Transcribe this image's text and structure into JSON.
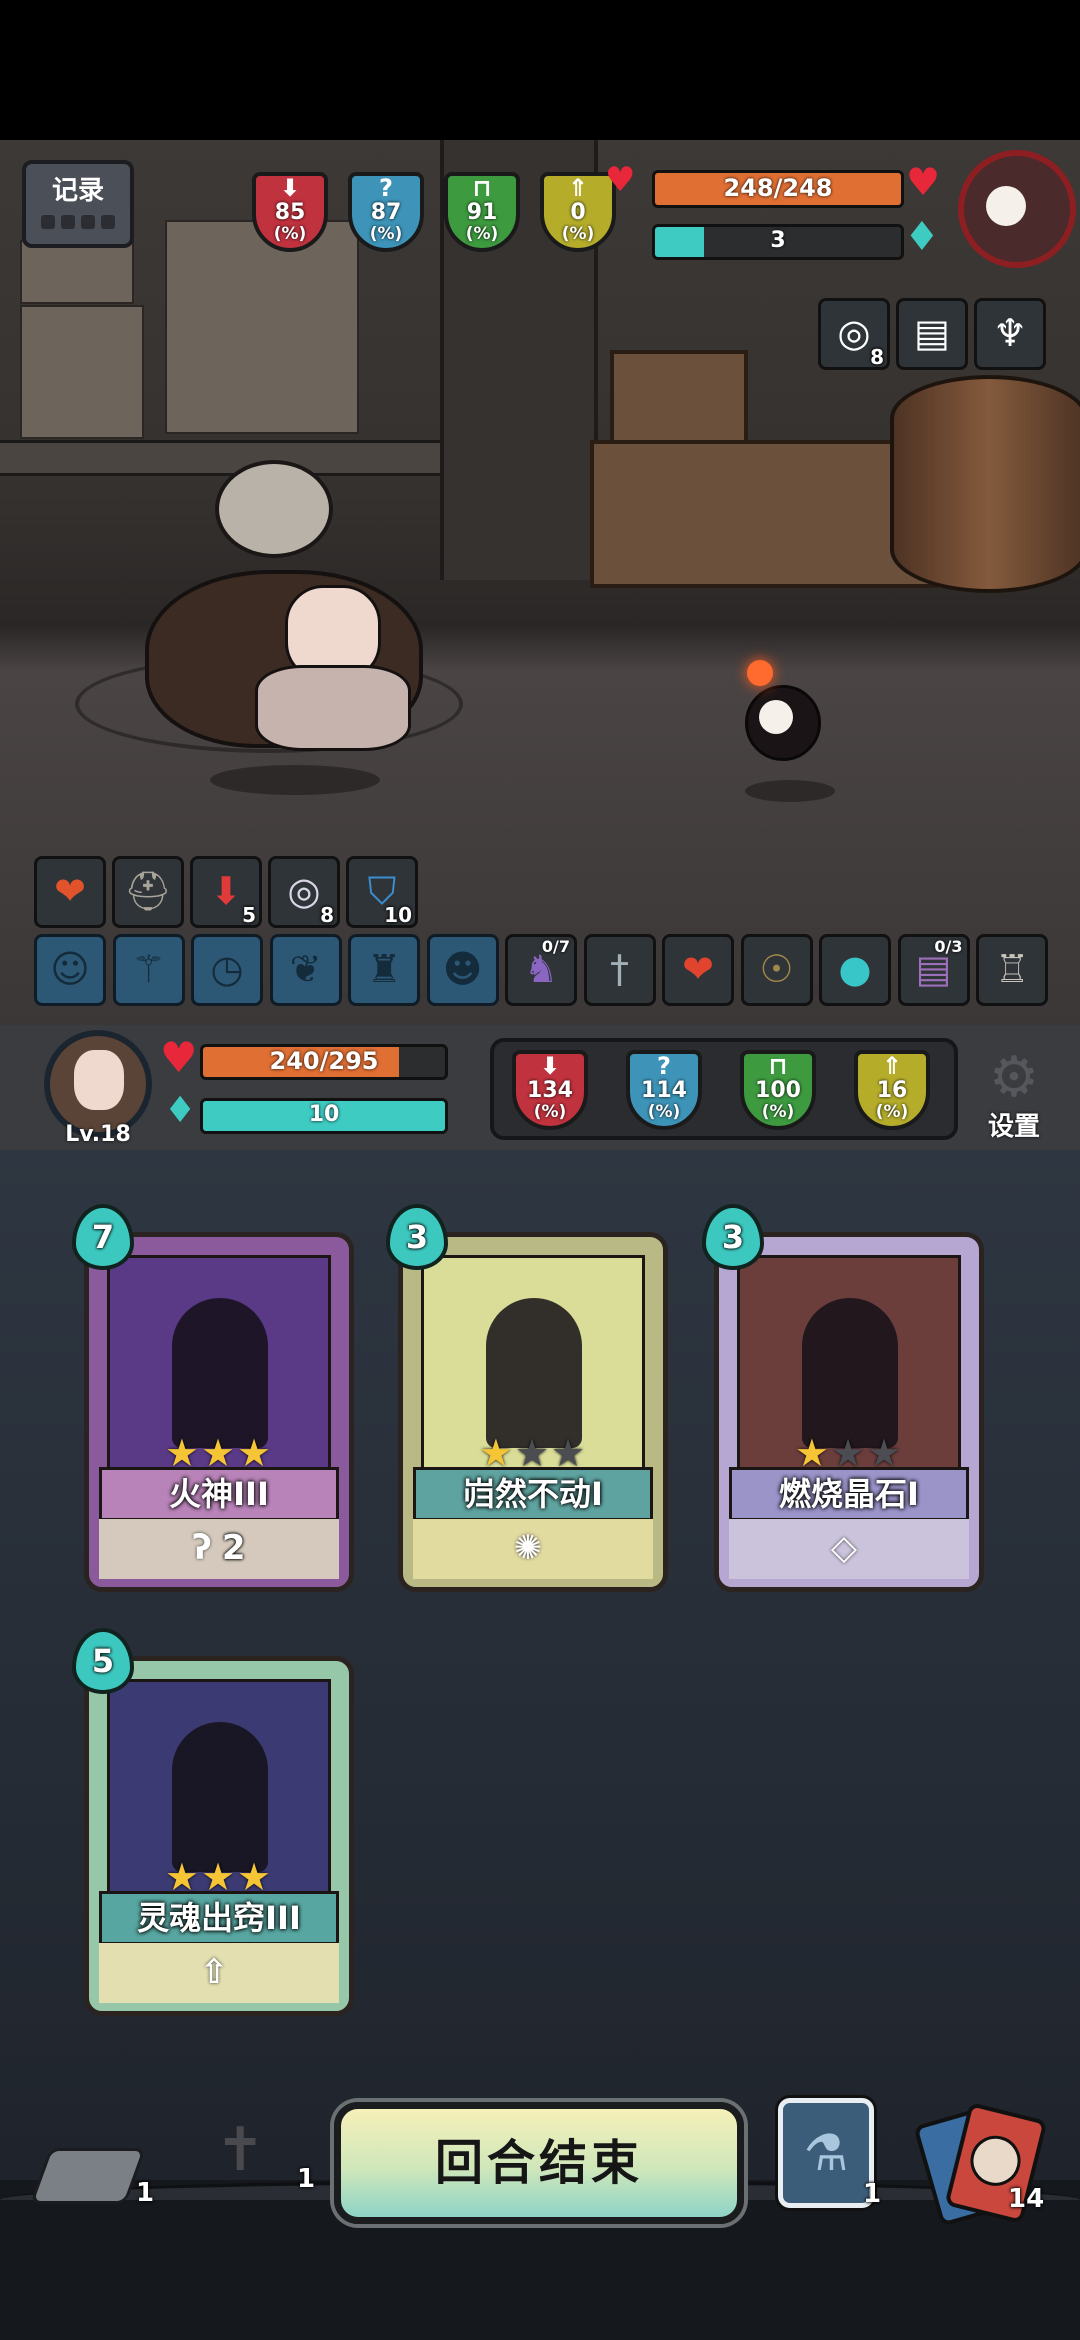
{
  "top_hud": {
    "record_label": "记录",
    "stats": [
      {
        "icon": "red-sword-icon",
        "value": "85",
        "unit": "(%)",
        "color": "#c0323e"
      },
      {
        "icon": "blue-question-icon",
        "value": "87",
        "unit": "(%)",
        "color": "#3d94b8"
      },
      {
        "icon": "green-guard-icon",
        "value": "91",
        "unit": "(%)",
        "color": "#3d9a3f"
      },
      {
        "icon": "yellow-arrow-icon",
        "value": "0",
        "unit": "(%)",
        "color": "#b5ad2a"
      }
    ],
    "enemy_hp": "248/248",
    "enemy_hp_fraction": 1.0,
    "enemy_energy": "3",
    "enemy_energy_fraction": 0.2,
    "enemy_buffs": [
      {
        "icon": "spiral-icon",
        "count": "8"
      },
      {
        "icon": "book-icon",
        "count": ""
      },
      {
        "icon": "gargoyle-icon",
        "count": ""
      }
    ]
  },
  "player_buffs": [
    {
      "icon": "fire-heart-icon",
      "count": ""
    },
    {
      "icon": "helmet-icon",
      "count": ""
    },
    {
      "icon": "down-arrow-shield-icon",
      "count": "5"
    },
    {
      "icon": "spiral-icon",
      "count": "8"
    },
    {
      "icon": "blue-shield-icon",
      "count": "10"
    }
  ],
  "equipment_slots": [
    {
      "icon": "cat-slot-icon",
      "badge": ""
    },
    {
      "icon": "staff-slot-icon",
      "badge": ""
    },
    {
      "icon": "clock-slot-icon",
      "badge": ""
    },
    {
      "icon": "wing-slot-icon",
      "badge": ""
    },
    {
      "icon": "torso-slot-icon",
      "badge": ""
    },
    {
      "icon": "mask-slot-icon",
      "badge": ""
    },
    {
      "icon": "wizard-figure-icon",
      "badge": "0/7"
    },
    {
      "icon": "dagger-icon",
      "badge": ""
    },
    {
      "icon": "strawberry-icon",
      "badge": ""
    },
    {
      "icon": "masquerade-mask-icon",
      "badge": ""
    },
    {
      "icon": "teal-orb-icon",
      "badge": ""
    },
    {
      "icon": "spellbook-icon",
      "badge": "0/3"
    },
    {
      "icon": "armor-icon",
      "badge": ""
    }
  ],
  "player_hud": {
    "level": "Lv.18",
    "hp": "240/295",
    "hp_fraction": 0.81,
    "energy": "10",
    "energy_fraction": 1.0,
    "stats": [
      {
        "icon": "red-sword-icon",
        "value": "134",
        "unit": "(%)",
        "color": "#c0323e"
      },
      {
        "icon": "blue-question-icon",
        "value": "114",
        "unit": "(%)",
        "color": "#3d94b8"
      },
      {
        "icon": "green-guard-icon",
        "value": "100",
        "unit": "(%)",
        "color": "#3d9a3f"
      },
      {
        "icon": "yellow-arrow-icon",
        "value": "16",
        "unit": "(%)",
        "color": "#b5ad2a"
      }
    ],
    "settings_label": "设置"
  },
  "cards": [
    {
      "name": "火神III",
      "cost": "7",
      "stars_filled": 3,
      "stars_total": 3,
      "art_color": "#5a3a86",
      "frame_color": "#8a5a9d",
      "name_color": "#b883b8",
      "bottom_color": "#d4c9bc",
      "bottom_text": "2",
      "bottom_icon": "staff-hook-icon"
    },
    {
      "name": "岿然不动I",
      "cost": "3",
      "stars_filled": 1,
      "stars_total": 3,
      "art_color": "#d9dd98",
      "frame_color": "#b9b985",
      "name_color": "#5fa3a0",
      "bottom_color": "#e2dba0",
      "bottom_text": "",
      "bottom_icon": "whistle-icon"
    },
    {
      "name": "燃烧晶石I",
      "cost": "3",
      "stars_filled": 1,
      "stars_total": 3,
      "art_color": "#6b3e3c",
      "frame_color": "#b5a6d2",
      "name_color": "#9a94c9",
      "bottom_color": "#cbc3dc",
      "bottom_text": "",
      "bottom_icon": "diamond-icon"
    },
    {
      "name": "灵魂出窍III",
      "cost": "5",
      "stars_filled": 3,
      "stars_total": 3,
      "art_color": "#3b3a73",
      "frame_color": "#97c7a9",
      "name_color": "#58a6a1",
      "bottom_color": "#e3dfb0",
      "bottom_text": "",
      "bottom_icon": "up-arrow-icon"
    }
  ],
  "bottom": {
    "discard_count": "1",
    "grave_count": "1",
    "end_turn_label": "回合结束",
    "potion_count": "1",
    "draw_count": "14"
  }
}
